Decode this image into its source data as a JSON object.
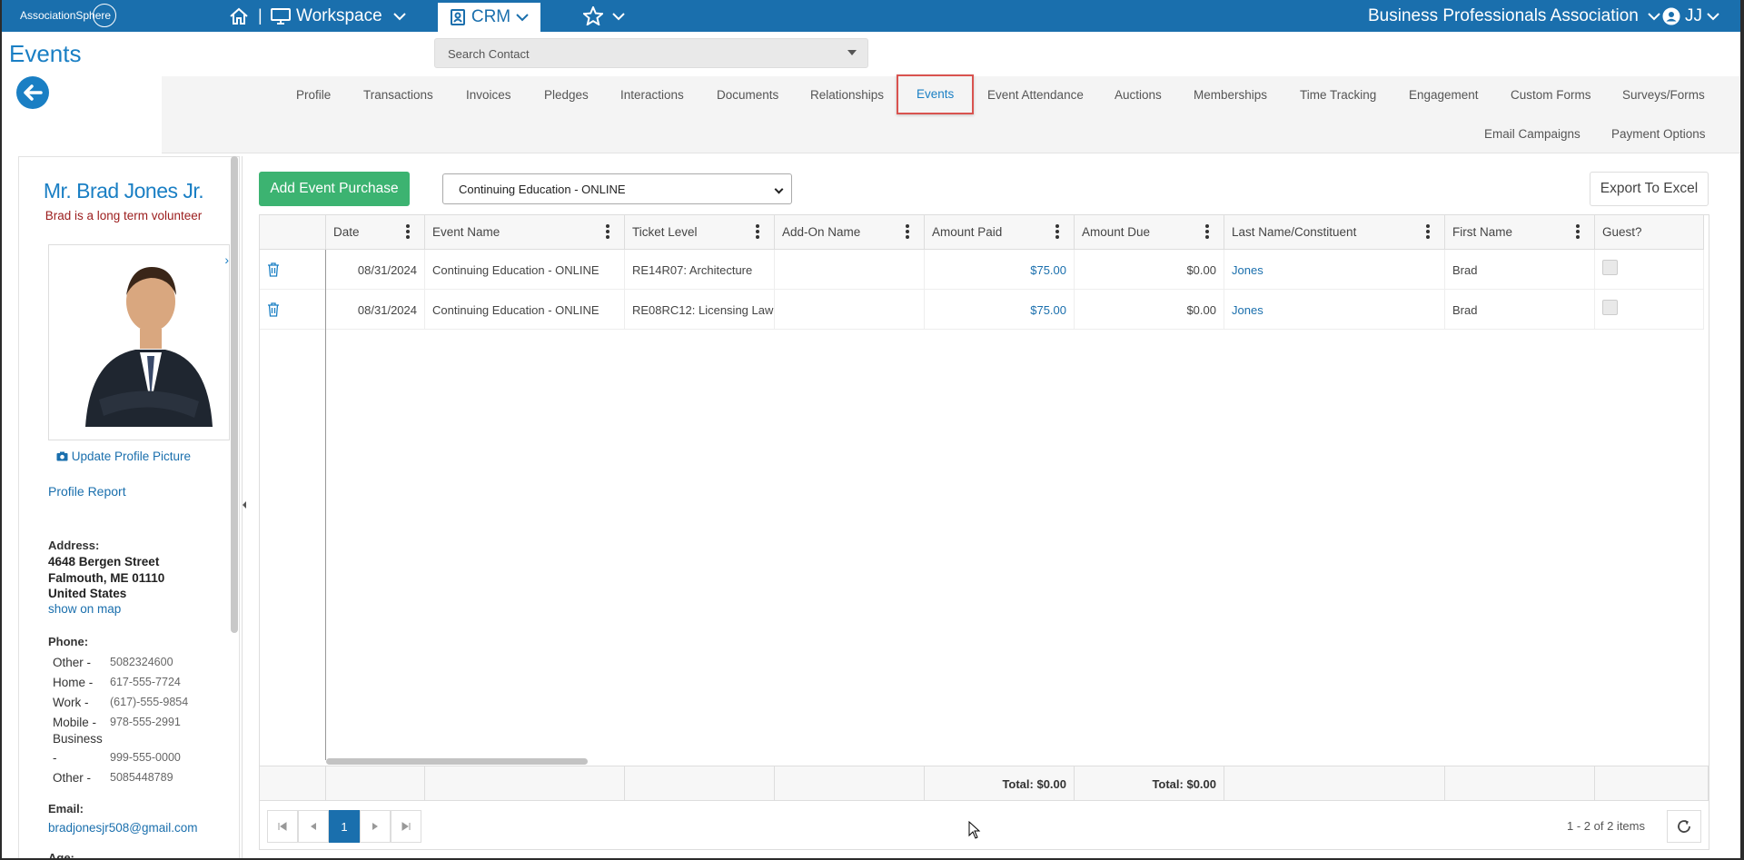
{
  "topbar": {
    "logo_text": "AssociationSphere",
    "workspace_label": "Workspace",
    "crm_label": "CRM",
    "org_name": "Business Professionals Association",
    "user_initials": "JJ"
  },
  "page": {
    "title": "Events",
    "search_placeholder": "Search Contact"
  },
  "tabs": [
    {
      "label": "Profile"
    },
    {
      "label": "Transactions"
    },
    {
      "label": "Invoices"
    },
    {
      "label": "Pledges"
    },
    {
      "label": "Interactions"
    },
    {
      "label": "Documents"
    },
    {
      "label": "Relationships"
    },
    {
      "label": "Events",
      "active": true
    },
    {
      "label": "Event Attendance"
    },
    {
      "label": "Auctions"
    },
    {
      "label": "Memberships"
    },
    {
      "label": "Time Tracking"
    },
    {
      "label": "Engagement"
    },
    {
      "label": "Custom Forms"
    },
    {
      "label": "Surveys/Forms"
    },
    {
      "label": "Email Campaigns"
    },
    {
      "label": "Payment Options"
    }
  ],
  "contact": {
    "name": "Mr. Brad Jones Jr.",
    "note": "Brad is a long term volunteer",
    "update_picture": "Update Profile Picture",
    "profile_report": "Profile Report",
    "address_label": "Address:",
    "address_lines": [
      "4648 Bergen Street",
      "Falmouth, ME 01110",
      "United States"
    ],
    "show_on_map": "show on map",
    "phone_label": "Phone:",
    "phones": [
      {
        "type": "Other -",
        "value": "5082324600"
      },
      {
        "type": "Home -",
        "value": "617-555-7724"
      },
      {
        "type": "Work -",
        "value": "(617)-555-9854"
      },
      {
        "type": "Mobile -",
        "value": "978-555-2991"
      },
      {
        "type": "Business",
        "value": ""
      },
      {
        "type": "-",
        "value": "999-555-0000"
      },
      {
        "type": "Other -",
        "value": "5085448789"
      }
    ],
    "email_label": "Email:",
    "email": "bradjonesjr508@gmail.com",
    "age_label": "Age:"
  },
  "toolbar": {
    "add_button": "Add Event Purchase",
    "selected_event": "Continuing Education - ONLINE",
    "export_button": "Export To Excel"
  },
  "grid": {
    "columns": [
      "Date",
      "Event Name",
      "Ticket Level",
      "Add-On Name",
      "Amount Paid",
      "Amount Due",
      "Last Name/Constituent",
      "First Name",
      "Guest?"
    ],
    "rows": [
      [
        "08/31/2024",
        "Continuing Education - ONLINE",
        "RE14R07: Architecture",
        "",
        "$75.00",
        "$0.00",
        "Jones",
        "Brad",
        ""
      ],
      [
        "08/31/2024",
        "Continuing Education - ONLINE",
        "RE08RC12: Licensing Law",
        "",
        "$75.00",
        "$0.00",
        "Jones",
        "Brad",
        ""
      ]
    ],
    "totals": {
      "amount_paid": "Total: $0.00",
      "amount_due": "Total: $0.00"
    },
    "pager": {
      "current_page": "1",
      "items_text": "1 - 2 of 2 items"
    }
  },
  "colors": {
    "topbar": "#1a6fad",
    "accent": "#1a7fc4",
    "add_button": "#3cb371",
    "active_tab_border": "#d9534f"
  }
}
